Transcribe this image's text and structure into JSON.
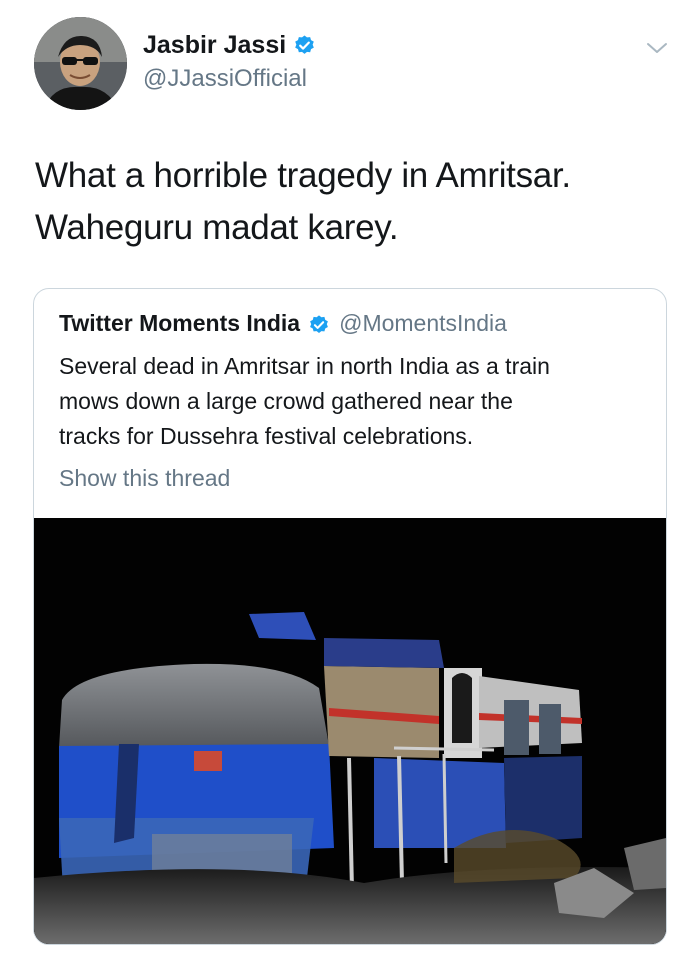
{
  "tweet": {
    "author": {
      "name": "Jasbir Jassi",
      "handle": "@JJassiOfficial",
      "verified": true
    },
    "text_lines": [
      "What a horrible tragedy in Amritsar.",
      "Waheguru madat karey."
    ],
    "quoted": {
      "name": "Twitter Moments India",
      "handle": "@MomentsIndia",
      "verified": true,
      "text_lines": [
        "Several dead in Amritsar in north India as a train",
        "mows down a large crowd gathered near the",
        "tracks for Dussehra festival celebrations."
      ],
      "show_thread": "Show this thread",
      "media": {
        "type": "photo"
      }
    }
  },
  "icons": {
    "verified": "verified-badge-icon",
    "more": "chevron-down-icon"
  },
  "colors": {
    "verified_blue": "#1da1f2",
    "secondary_text": "#657786",
    "primary_text": "#14171a",
    "card_border": "#ccd6dd"
  }
}
